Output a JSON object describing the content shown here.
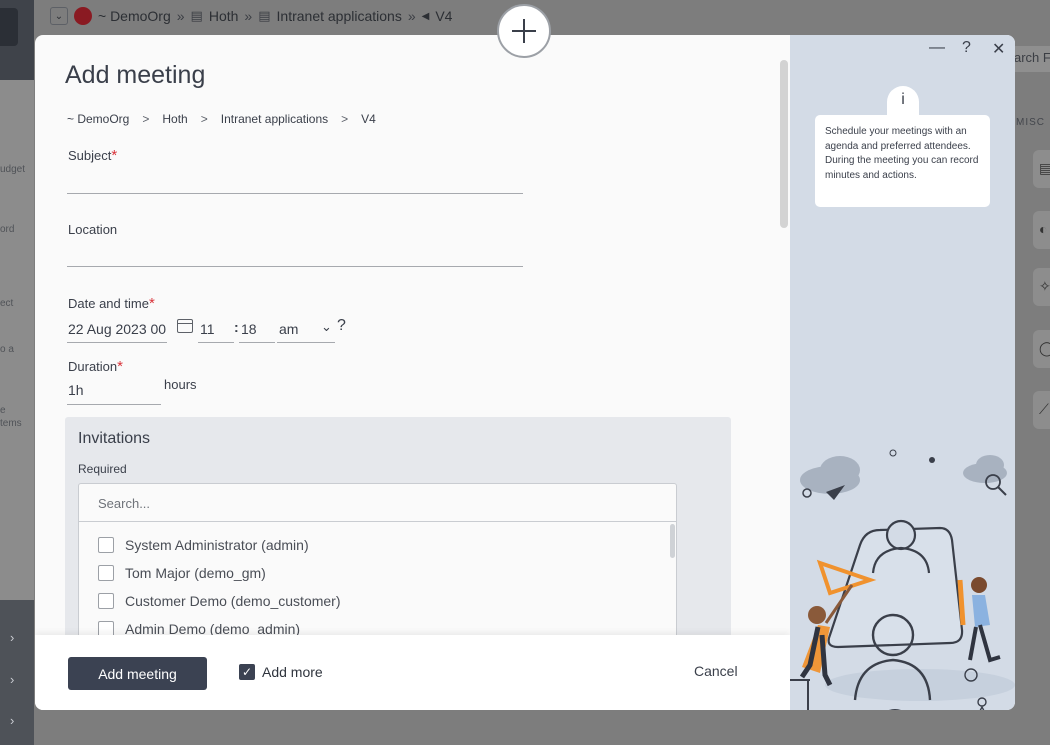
{
  "background": {
    "breadcrumb": {
      "org": "~ DemoOrg",
      "items": [
        "Hoth",
        "Intranet applications"
      ],
      "current": "V4",
      "separator": "»"
    },
    "search_fragment": "arch F",
    "misc_label": "MISC",
    "side_labels": [
      "udget",
      "ord",
      "ect",
      "o a",
      "e",
      "tems"
    ]
  },
  "modal": {
    "title": "Add meeting",
    "breadcrumb": [
      "~ DemoOrg",
      "Hoth",
      "Intranet applications",
      "V4"
    ],
    "breadcrumb_separator": ">",
    "fields": {
      "subject": {
        "label": "Subject",
        "value": ""
      },
      "location": {
        "label": "Location",
        "value": ""
      },
      "datetime": {
        "label": "Date and time",
        "date": "22 Aug 2023 00",
        "hour": "11",
        "minute": "18",
        "meridiem": "am",
        "help": "?"
      },
      "duration": {
        "label": "Duration",
        "value": "1h",
        "unit": "hours"
      }
    },
    "invitations": {
      "title": "Invitations",
      "required_label": "Required",
      "search_placeholder": "Search...",
      "users": [
        "System Administrator (admin)",
        "Tom Major (demo_gm)",
        "Customer Demo (demo_customer)",
        "Admin Demo (demo_admin)"
      ]
    },
    "footer": {
      "primary_label": "Add meeting",
      "add_more_label": "Add more",
      "add_more_checked": true,
      "cancel_label": "Cancel"
    }
  },
  "info_panel": {
    "controls": {
      "minimize": "—",
      "help": "?",
      "close": "✕"
    },
    "tab_icon": "i",
    "text": "Schedule your meetings with an agenda and preferred attendees. During the meeting you can record minutes and actions."
  },
  "colors": {
    "primary_button": "#3b4252",
    "required_asterisk": "#d9333a",
    "info_panel_bg": "#d3dbe6",
    "accent_orange": "#f0922e"
  }
}
